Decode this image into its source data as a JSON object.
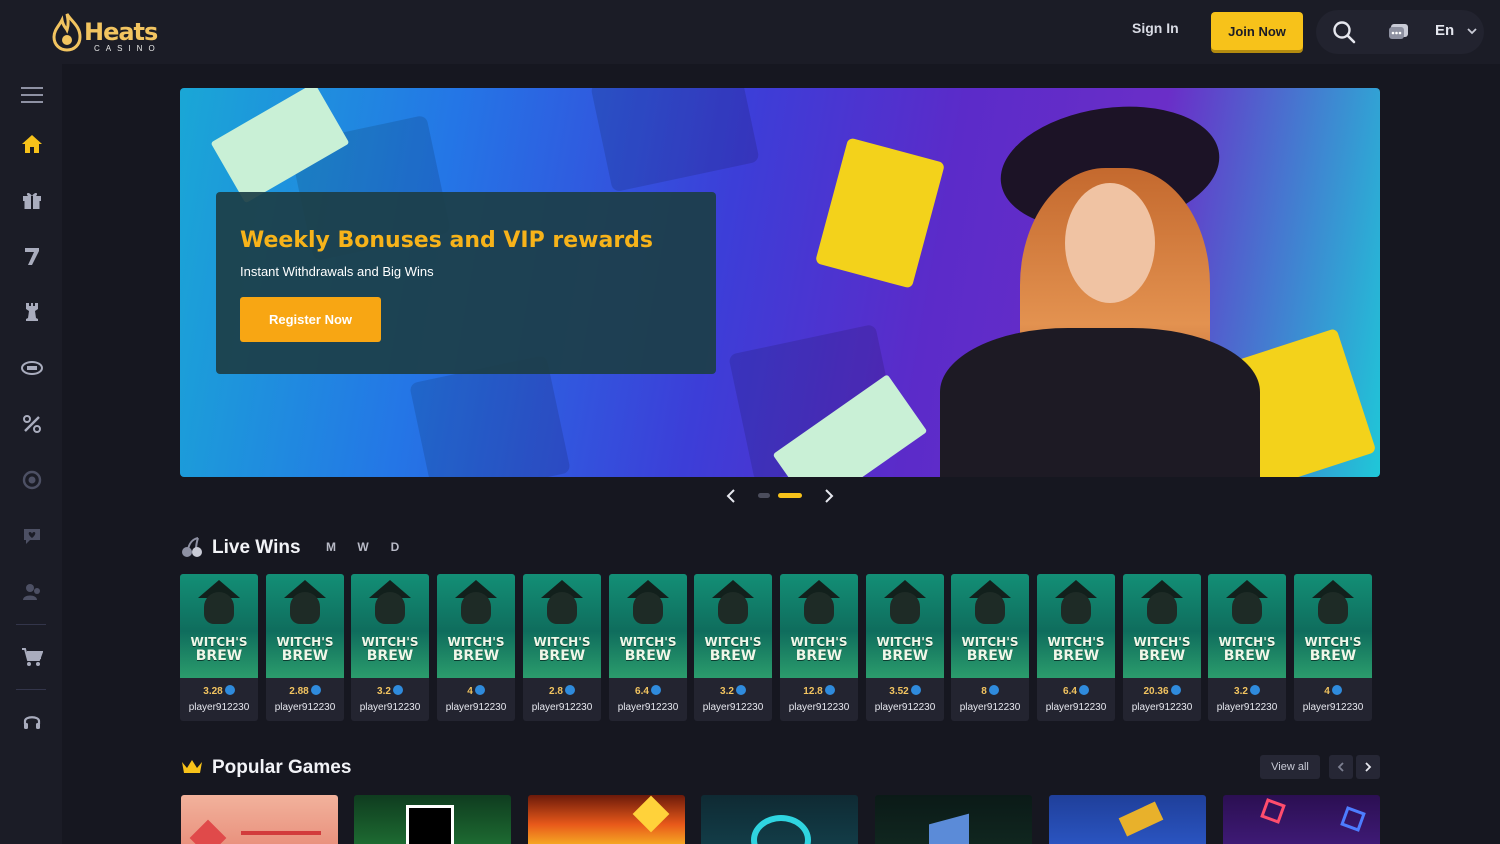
{
  "header": {
    "logo_brand": "Heats",
    "logo_sub": "CASINO",
    "sign_in": "Sign In",
    "join_now": "Join Now",
    "language": "En"
  },
  "sidebar": {
    "items": [
      {
        "icon": "menu-icon"
      },
      {
        "icon": "home-icon",
        "active": true
      },
      {
        "icon": "gift-icon"
      },
      {
        "icon": "slot-seven-icon"
      },
      {
        "icon": "rook-icon"
      },
      {
        "icon": "live-table-icon"
      },
      {
        "icon": "discount-icon"
      },
      {
        "icon": "vip-icon"
      },
      {
        "icon": "heart-chat-icon"
      },
      {
        "icon": "users-icon"
      },
      {
        "icon": "cart-icon"
      },
      {
        "icon": "headset-icon"
      }
    ]
  },
  "banner": {
    "title": "Weekly Bonuses and VIP rewards",
    "subtitle": "Instant Withdrawals and Big Wins",
    "cta": "Register Now"
  },
  "live_wins": {
    "title": "Live Wins",
    "filters": [
      "M",
      "W",
      "D"
    ],
    "game_title_1": "WITCH'S",
    "game_title_2": "BREW",
    "wins": [
      {
        "amount": "3.28",
        "player": "player912230"
      },
      {
        "amount": "2.88",
        "player": "player912230"
      },
      {
        "amount": "3.2",
        "player": "player912230"
      },
      {
        "amount": "4",
        "player": "player912230"
      },
      {
        "amount": "2.8",
        "player": "player912230"
      },
      {
        "amount": "6.4",
        "player": "player912230"
      },
      {
        "amount": "3.2",
        "player": "player912230"
      },
      {
        "amount": "12.8",
        "player": "player912230"
      },
      {
        "amount": "3.52",
        "player": "player912230"
      },
      {
        "amount": "8",
        "player": "player912230"
      },
      {
        "amount": "6.4",
        "player": "player912230"
      },
      {
        "amount": "20.36",
        "player": "player912230"
      },
      {
        "amount": "3.2",
        "player": "player912230"
      },
      {
        "amount": "4",
        "player": "player912230"
      }
    ]
  },
  "popular_games": {
    "title": "Popular Games",
    "view_all": "View all"
  },
  "colors": {
    "accent": "#f7c21a",
    "cta_orange": "#f8a613",
    "title_orange": "#f7b31a",
    "background": "#161720"
  }
}
